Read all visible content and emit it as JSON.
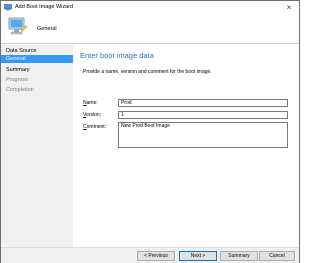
{
  "window": {
    "title": "Add Boot Image Wizard",
    "close_glyph": "×"
  },
  "header": {
    "title": "General",
    "icon": "computer-wizard-icon"
  },
  "nav": {
    "items": [
      {
        "label": "Data Source",
        "state": "normal"
      },
      {
        "label": "General",
        "state": "active"
      },
      {
        "label": "Summary",
        "state": "normal"
      },
      {
        "label": "Progress",
        "state": "disabled"
      },
      {
        "label": "Completion",
        "state": "disabled"
      }
    ]
  },
  "main": {
    "title": "Enter boot image data",
    "description": "Provide a name, version and comment for the boot image.",
    "name": {
      "label_key": "N",
      "label_rest": "ame:",
      "value": "Prod"
    },
    "version": {
      "label_key": "V",
      "label_rest": "ersion:",
      "value": "1"
    },
    "comment": {
      "label_key": "C",
      "label_rest": "omment:",
      "value": "New Prod Boot Image"
    }
  },
  "footer": {
    "previous": "< Previous",
    "next": "Next >",
    "summary": "Summary",
    "cancel": "Cancel"
  },
  "colors": {
    "accent": "#3399ff",
    "title_blue": "#2a72c8",
    "nav_bg": "#f0f0f0"
  }
}
